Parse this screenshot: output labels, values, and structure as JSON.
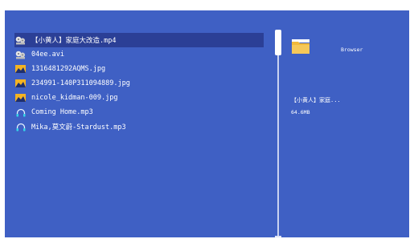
{
  "files": [
    {
      "name": "【小黄人】家庭大改造.mp4",
      "icon": "film-reel-icon",
      "selected": true
    },
    {
      "name": "04ee.avi",
      "icon": "film-reel-icon",
      "selected": false
    },
    {
      "name": "1316481292AQMS.jpg",
      "icon": "image-icon",
      "selected": false
    },
    {
      "name": "234991-140P311094889.jpg",
      "icon": "image-icon",
      "selected": false
    },
    {
      "name": "nicole_kidman-009.jpg",
      "icon": "image-icon",
      "selected": false
    },
    {
      "name": "Coming Home.mp3",
      "icon": "headphones-icon",
      "selected": false
    },
    {
      "name": "Mika,莫文蔚-Stardust.mp3",
      "icon": "headphones-icon",
      "selected": false
    }
  ],
  "preview": {
    "label": "Browser",
    "icon": "folder-icon",
    "selected_name": "【小黄人】家庭...",
    "selected_size": "64.6MB"
  },
  "colors": {
    "background": "#3f60c4",
    "selection": "#2b3f96",
    "folder": "#f2b93b"
  }
}
